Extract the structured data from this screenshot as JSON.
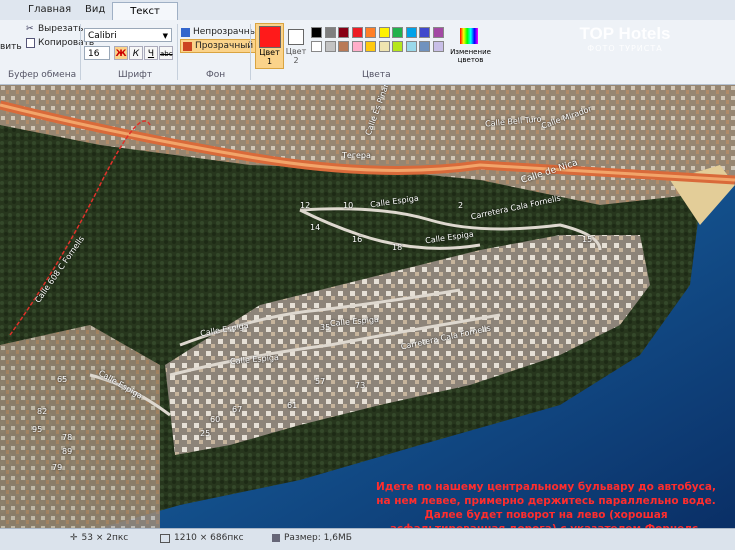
{
  "tabs": {
    "home": "Главная",
    "view": "Вид",
    "text": "Текст"
  },
  "clipboard": {
    "paste_fragment": "вить",
    "cut": "Вырезать",
    "copy": "Копировать",
    "label": "Буфер обмена"
  },
  "font": {
    "family": "Calibri",
    "size": "16",
    "label": "Шрифт",
    "bold": "Ж",
    "italic": "К",
    "underline": "Ч",
    "strike": "abc"
  },
  "background": {
    "opaque": "Непрозрачный",
    "transparent": "Прозрачный",
    "label": "Фон"
  },
  "colors": {
    "color1_label": "Цвет\n1",
    "color2_label": "Цвет\n2",
    "edit_colors": "Изменение\nцветов",
    "label": "Цвета",
    "color1": "#ff1a1a",
    "color2": "#ffffff",
    "palette_row1": [
      "#000000",
      "#7f7f7f",
      "#880015",
      "#ed1c24",
      "#ff7f27",
      "#fff200",
      "#22b14c",
      "#00a2e8",
      "#3f48cc",
      "#a349a4"
    ],
    "palette_row2": [
      "#ffffff",
      "#c3c3c3",
      "#b97a57",
      "#ffaec9",
      "#ffc90e",
      "#efe4b0",
      "#b5e61d",
      "#99d9ea",
      "#7092be",
      "#c8bfe7"
    ]
  },
  "watermark": {
    "brand": "TOP Hotels",
    "sub": "ФОТО ТУРИСТА"
  },
  "map": {
    "streets": {
      "calle_mirador": "Calle Mirador",
      "calle_de_nica": "Calle de Nica",
      "carretera_cala_fornells": "Carretera Cala Fornells",
      "calle_espiga_1": "Calle Espiga",
      "calle_espiga_2": "Calle Espiga",
      "calle_espiga_3": "Calle Espiga",
      "calle_espiga_4": "Calle Espiga",
      "calle_espiga_5": "Calle Espiga",
      "calle_espiga_6": "Calle Espiga",
      "calle_608": "Calle 608 C Fornells",
      "calle_bell_turo": "Calle Bell Turo",
      "tegera": "Тегера",
      "calle_es_pinar": "Calle Es Pinar",
      "carretera_cala_fornells_2": "Carretera Cala Fornells"
    },
    "numbers": [
      "12",
      "10",
      "14",
      "16",
      "18",
      "2",
      "15",
      "35",
      "65",
      "82",
      "95",
      "78",
      "89",
      "79",
      "57",
      "67",
      "60",
      "61",
      "73",
      "25"
    ],
    "note": "Идете по нашему центральному бульвару до автобуса, на нем левее, примерно держитесь параллельно воде. Далее будет поворот на лево (хорошая асфальтированная дорога) с указателем Форнелс. Идите туда. Далее сами сориентируетесь и спросите как спуститься вниз к воде."
  },
  "status": {
    "cursor": "53 × 2пкс",
    "dimensions": "1210 × 686пкс",
    "size": "Размер: 1,6МБ"
  }
}
